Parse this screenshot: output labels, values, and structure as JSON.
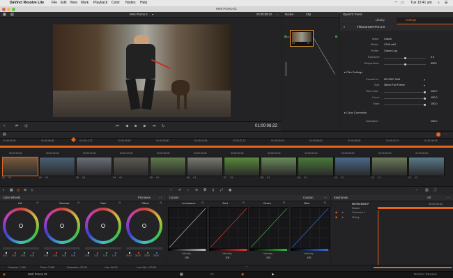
{
  "menubar": {
    "app": "DaVinci Resolve Lite",
    "items": [
      "File",
      "Edit",
      "View",
      "Mark",
      "Playback",
      "Color",
      "Nodes",
      "Help"
    ],
    "clock": "Tue 10:41 am"
  },
  "window": {
    "title": "Web Promo 01"
  },
  "viewer": {
    "clip_name": "Web Promo 5",
    "timecode_top": "00:00:08:22",
    "timecode": "01:00:08:22"
  },
  "nodes": {
    "title": "Nodes",
    "clip_tab": "Clip",
    "node_label_left": "01",
    "node_label_right": "fx"
  },
  "ofx": {
    "title": "OpenFX Panel",
    "tabs": [
      "Library",
      "Settings"
    ],
    "active_tab": "Settings",
    "plugin": "FilmConvert Pro 2.0",
    "rows": [
      {
        "label": "Make:",
        "value": "Canon"
      },
      {
        "label": "Model:",
        "value": "C100 mk2"
      },
      {
        "label": "Profile:",
        "value": "Canon Log"
      },
      {
        "label": "Exposure:",
        "value": "0.0",
        "level": 0.5
      },
      {
        "label": "Temperature:",
        "value": "5500",
        "level": 0.5
      }
    ],
    "film_section": "Film Settings",
    "film_rows": [
      {
        "label": "Convert to:",
        "value": "KD 5207 Vis3"
      },
      {
        "label": "Size:",
        "value": "35mm Full Frame"
      },
      {
        "label": "Film Color:",
        "value": "100.0",
        "level": 1.0
      },
      {
        "label": "Curve:",
        "value": "100.0",
        "level": 1.0
      },
      {
        "label": "Grain:",
        "value": "100.0",
        "level": 1.0
      }
    ],
    "color_section": "Color Correction",
    "saturation_label": "Saturation:",
    "saturation_value": "100.0"
  },
  "timeline": {
    "ruler": [
      "01:00:00:00",
      "01:00:06:06",
      "01:00:12:12",
      "01:00:18:18",
      "01:00:25:00",
      "01:00:31:06",
      "01:00:37:12",
      "01:00:43:18",
      "01:00:50:00",
      "01:00:56:06",
      "01:01:02:12",
      "01:01:08:18"
    ],
    "clips": [
      {
        "tc": "00:00:00:00",
        "num": "01",
        "track": "V1",
        "color": "#7a5a3c"
      },
      {
        "tc": "00:00:00:00",
        "num": "02",
        "track": "V1",
        "color": "#4a6075"
      },
      {
        "tc": "00:00:00:00",
        "num": "03",
        "track": "V1",
        "color": "#6a6f78"
      },
      {
        "tc": "00:00:00:00",
        "num": "04",
        "track": "V1",
        "color": "#5d5a52"
      },
      {
        "tc": "00:00:00:00",
        "num": "05",
        "track": "V1",
        "color": "#5f7a4a"
      },
      {
        "tc": "00:00:00:00",
        "num": "06",
        "track": "V1",
        "color": "#777a72"
      },
      {
        "tc": "00:00:00:00",
        "num": "07",
        "track": "V1",
        "color": "#5a8a3a"
      },
      {
        "tc": "00:00:00:00",
        "num": "08",
        "track": "V1",
        "color": "#6a8a5a"
      },
      {
        "tc": "00:00:00:00",
        "num": "09",
        "track": "V1",
        "color": "#4a7a3a"
      },
      {
        "tc": "00:00:00:00",
        "num": "10",
        "track": "V1",
        "color": "#4a6a8a"
      },
      {
        "tc": "00:00:00:00",
        "num": "11",
        "track": "V1",
        "color": "#6a7a5a"
      },
      {
        "tc": "00:00:00:00",
        "num": "12",
        "track": "V1",
        "color": "#5a7a8a"
      }
    ]
  },
  "color_wheels": {
    "title": "Color Wheels",
    "mode": "Primaries",
    "wheels": [
      {
        "name": "Lift",
        "values": [
          "0.00",
          "0.00",
          "0.00",
          "0.00"
        ]
      },
      {
        "name": "Gamma",
        "values": [
          "0.00",
          "0.00",
          "0.00",
          "0.00"
        ]
      },
      {
        "name": "Gain",
        "values": [
          "1.00",
          "1.00",
          "1.00",
          "1.00"
        ]
      },
      {
        "name": "Offset",
        "values": [
          "25.00",
          "25.00",
          "25.00",
          "25.00"
        ]
      }
    ],
    "footer": {
      "contrast": "Contrast: 1.000",
      "pivot": "Pivot: 0.435",
      "saturation": "Saturation: 50.00",
      "hue": "Hue: 50.00",
      "lum_mix": "Lum Mix: 100.00"
    }
  },
  "curves": {
    "title": "Curves",
    "mode": "Custom",
    "channels": [
      {
        "name": "Luminance",
        "intensity_label": "Intensity",
        "intensity": "100",
        "color": "#bdbdbd"
      },
      {
        "name": "Red",
        "intensity_label": "Intensity",
        "intensity": "100",
        "color": "#d63a3a"
      },
      {
        "name": "Green",
        "intensity_label": "Intensity",
        "intensity": "100",
        "color": "#3ab04a"
      },
      {
        "name": "Blue",
        "intensity_label": "Intensity",
        "intensity": "100",
        "color": "#3a6ad6"
      }
    ]
  },
  "keyframes": {
    "title": "Keyframes",
    "filter": "All",
    "timecode": "00:00:08:07",
    "timecode_right": "00:00:00:02",
    "tracks": [
      "Master",
      "Corrector 1",
      "Sizing"
    ]
  },
  "bottom": {
    "project": "Web Promo 01",
    "app_label": "DaVinci Resolve"
  },
  "colors": {
    "accent": "#e8661c",
    "bg": "#1c1c1e"
  }
}
